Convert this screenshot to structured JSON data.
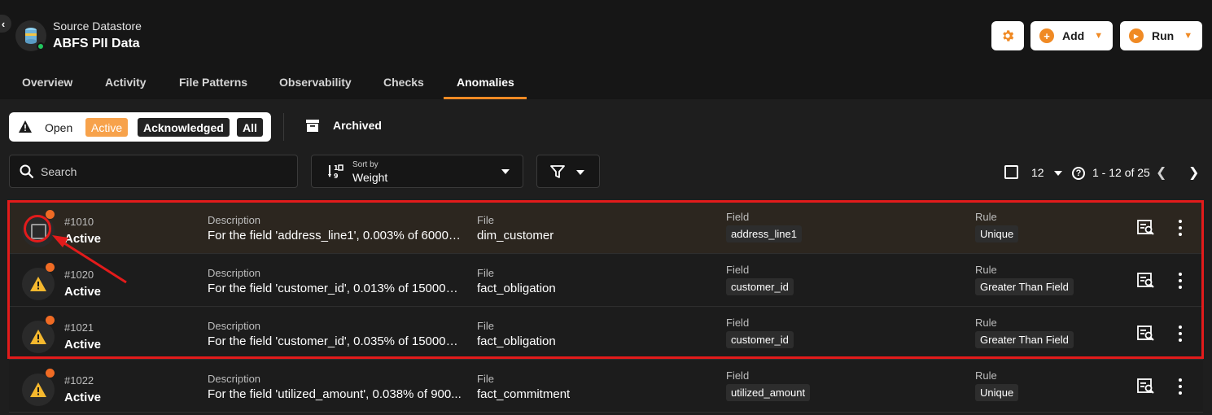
{
  "header": {
    "breadcrumb_label": "Source Datastore",
    "datastore_name": "ABFS PII Data",
    "add_label": "Add",
    "run_label": "Run"
  },
  "tabs": [
    {
      "label": "Overview"
    },
    {
      "label": "Activity"
    },
    {
      "label": "File Patterns"
    },
    {
      "label": "Observability"
    },
    {
      "label": "Checks"
    },
    {
      "label": "Anomalies",
      "active": true
    }
  ],
  "status_filter": {
    "open": "Open",
    "active": "Active",
    "acknowledged": "Acknowledged",
    "all": "All",
    "archived": "Archived"
  },
  "toolbar": {
    "search_placeholder": "Search",
    "sort_label": "Sort by",
    "sort_value": "Weight",
    "per_page": "12",
    "range": "1 - 12 of 25"
  },
  "columns": {
    "description": "Description",
    "file": "File",
    "field": "Field",
    "rule": "Rule"
  },
  "rows": [
    {
      "id": "#1010",
      "status": "Active",
      "description": "For the field 'address_line1', 0.003% of 60000 ...",
      "file": "dim_customer",
      "field": "address_line1",
      "rule": "Unique",
      "selected_checkbox": true
    },
    {
      "id": "#1020",
      "status": "Active",
      "description": "For the field 'customer_id', 0.013% of 150000 r...",
      "file": "fact_obligation",
      "field": "customer_id",
      "rule": "Greater Than Field"
    },
    {
      "id": "#1021",
      "status": "Active",
      "description": "For the field 'customer_id', 0.035% of 150000 r...",
      "file": "fact_obligation",
      "field": "customer_id",
      "rule": "Greater Than Field"
    },
    {
      "id": "#1022",
      "status": "Active",
      "description": "For the field 'utilized_amount', 0.038% of 900...",
      "file": "fact_commitment",
      "field": "utilized_amount",
      "rule": "Unique"
    }
  ],
  "colors": {
    "accent": "#f08a24",
    "warning": "#f5b82e",
    "highlight": "#e31b1b",
    "status_online": "#22c55e"
  },
  "icons": [
    "back-icon",
    "datastore-icon",
    "gear-icon",
    "plus-icon",
    "play-icon",
    "warning-icon",
    "archive-icon",
    "search-icon",
    "sort-icon",
    "filter-icon",
    "help-icon",
    "details-icon",
    "more-icon"
  ]
}
